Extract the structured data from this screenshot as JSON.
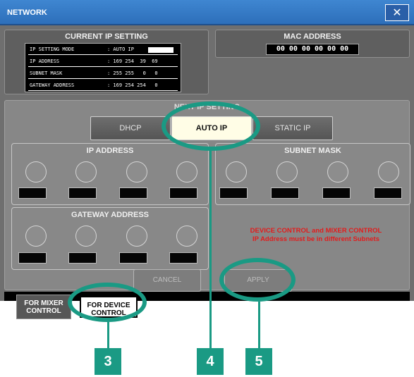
{
  "window": {
    "title": "NETWORK",
    "close_icon": "close-icon"
  },
  "current_ip": {
    "title": "CURRENT IP SETTING",
    "rows": [
      {
        "label": "IP SETTING MODE",
        "value": ": AUTO IP"
      },
      {
        "label": "IP ADDRESS",
        "value": ": 169 254  39  69"
      },
      {
        "label": "SUBNET MASK",
        "value": ": 255 255   0   0"
      },
      {
        "label": "GATEWAY ADDRESS",
        "value": ": 169 254 254   0"
      }
    ]
  },
  "mac": {
    "title": "MAC ADDRESS",
    "value": "00 00 00 00 00 00"
  },
  "next_ip": {
    "title": "NEXT IP SETTING",
    "modes": [
      "DHCP",
      "AUTO IP",
      "STATIC IP"
    ],
    "selected_mode": "AUTO IP",
    "groups": {
      "ip": "IP ADDRESS",
      "subnet": "SUBNET MASK",
      "gateway": "GATEWAY ADDRESS"
    }
  },
  "warning": {
    "line1": "DEVICE CONTROL and MIXER CONTROL",
    "line2": "IP Address must be in different Subnets"
  },
  "actions": {
    "cancel": "CANCEL",
    "apply": "APPLY"
  },
  "tabs": {
    "mixer_line1": "FOR MIXER",
    "mixer_line2": "CONTROL",
    "device_line1": "FOR DEVICE",
    "device_line2": "CONTROL",
    "selected": "FOR DEVICE CONTROL"
  },
  "callouts": [
    "3",
    "4",
    "5"
  ],
  "colors": {
    "titlebar": "#2d6fba",
    "callout": "#1a9a84",
    "warning": "#e21c1c",
    "selected_button": "#fffde6"
  }
}
